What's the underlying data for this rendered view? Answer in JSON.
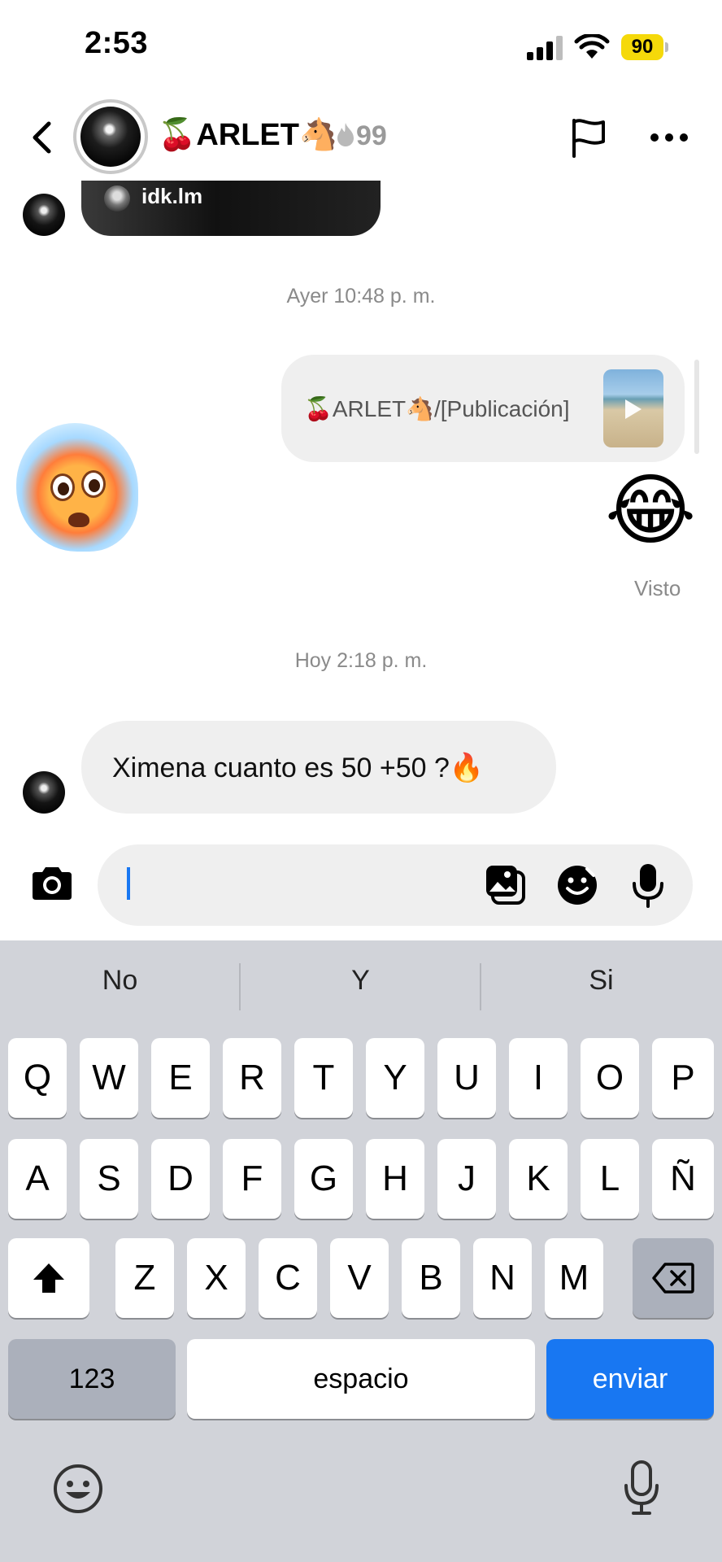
{
  "status_bar": {
    "time": "2:53",
    "battery": "90"
  },
  "header": {
    "back_icon": "chevron-left-icon",
    "name": "🍒ARLET🐴",
    "streak_icon": "fire-icon",
    "streak_count": "99",
    "flag_icon": "flag-icon",
    "more_icon": "more-horizontal-icon"
  },
  "chat": {
    "shared_post_user": "idk.lm",
    "divider_yesterday": "Ayer 10:48 p. m.",
    "sent_post_text": "🍒ARLET🐴/[Publicación]",
    "sent_emoji": "😂",
    "seen_label": "Visto",
    "divider_today": "Hoy 2:18 p. m.",
    "received_message": "Ximena cuanto es 50 +50 ?🔥"
  },
  "composer": {
    "camera_icon": "camera-icon",
    "gallery_icon": "gallery-icon",
    "sticker_icon": "sticker-icon",
    "mic_icon": "mic-icon",
    "value": ""
  },
  "keyboard": {
    "suggestions": [
      "No",
      "Y",
      "Si"
    ],
    "row1": [
      "Q",
      "W",
      "E",
      "R",
      "T",
      "Y",
      "U",
      "I",
      "O",
      "P"
    ],
    "row2": [
      "A",
      "S",
      "D",
      "F",
      "G",
      "H",
      "J",
      "K",
      "L",
      "Ñ"
    ],
    "row3": [
      "Z",
      "X",
      "C",
      "V",
      "B",
      "N",
      "M"
    ],
    "numbers_key": "123",
    "space_key": "espacio",
    "send_key": "enviar",
    "shift_icon": "shift-icon",
    "delete_icon": "backspace-icon",
    "emoji_icon": "emoji-icon",
    "dictation_icon": "dictation-mic-icon"
  },
  "colors": {
    "accent": "#1877f2",
    "bubble": "#efefef",
    "keyboard_bg": "#d1d3d9",
    "battery": "#f5d90a"
  }
}
